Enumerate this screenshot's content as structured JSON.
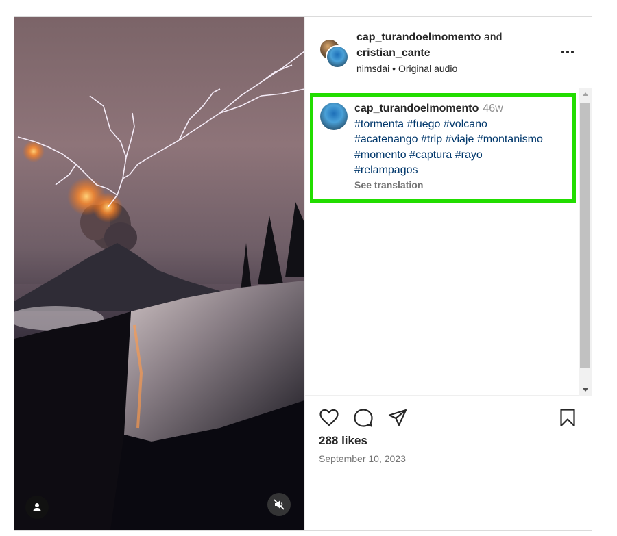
{
  "header": {
    "user1": "cap_turandoelmomento",
    "connector": "and",
    "user2": "cristian_cante",
    "audio_owner": "nimsdai",
    "separator": "•",
    "audio_label": "Original audio"
  },
  "caption": {
    "username": "cap_turandoelmomento",
    "time": "46w",
    "hashtags_line1": [
      "#tormenta",
      "#fuego",
      "#volcano"
    ],
    "hashtags_line2": [
      "#acatenango",
      "#trip",
      "#viaje",
      "#montanismo"
    ],
    "hashtags_line3": [
      "#momento",
      "#captura",
      "#rayo"
    ],
    "hashtags_line4": [
      "#relampagos"
    ],
    "see_translation": "See translation"
  },
  "stats": {
    "likes": "288 likes",
    "date": "September 10, 2023"
  },
  "colors": {
    "highlight_border": "#22dd00",
    "hashtag": "#00376b"
  },
  "icons": {
    "media": [
      "user-tag-icon",
      "muted-speaker-icon"
    ],
    "actions": [
      "heart-icon",
      "comment-icon",
      "share-icon",
      "bookmark-icon"
    ],
    "header": [
      "more-options-icon"
    ]
  }
}
